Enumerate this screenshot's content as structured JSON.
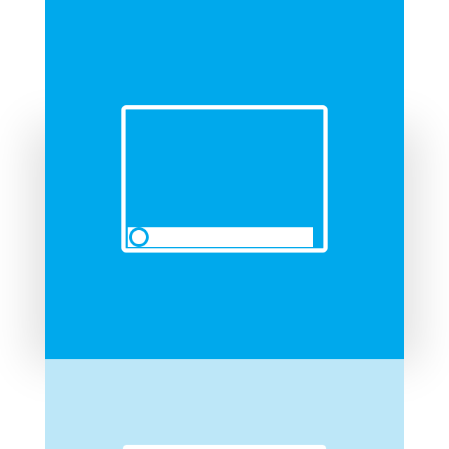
{
  "tile": {
    "icon": "media-player-icon",
    "background_color": "#00a9ec",
    "foreground_color": "#ffffff"
  },
  "reflection": {
    "background_color": "#bde7f8"
  }
}
